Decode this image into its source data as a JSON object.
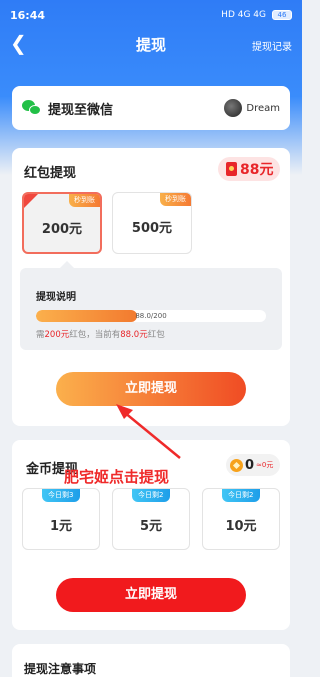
{
  "status_bar": {
    "time": "16:44",
    "indicators": "HD 4G 4G",
    "battery": "46"
  },
  "nav": {
    "back_icon": "chevron-left-icon",
    "title": "提现",
    "record_link": "提现记录"
  },
  "wechat": {
    "label": "提现至微信",
    "username": "Dream"
  },
  "red_packet": {
    "title": "红包提现",
    "balance": "88元",
    "options": [
      {
        "amount": "200元",
        "tag": "秒到账",
        "selected": true
      },
      {
        "amount": "500元",
        "tag": "秒到账",
        "selected": false
      }
    ],
    "explain": {
      "title": "提现说明",
      "progress_text": "88.0/200",
      "progress_fraction": 0.44,
      "note_prefix": "需",
      "note_need": "200元",
      "note_mid": "红包，当前有",
      "note_have": "88.0元",
      "note_suffix": "红包"
    },
    "button": "立即提现"
  },
  "gold": {
    "title": "金币提现",
    "coin_value": "0",
    "coin_equiv": "≈0元",
    "options": [
      {
        "amount": "1元",
        "tag": "今日剩3次"
      },
      {
        "amount": "5元",
        "tag": "今日剩2次"
      },
      {
        "amount": "10元",
        "tag": "今日剩2次"
      }
    ],
    "button": "立即提现"
  },
  "notes": {
    "title": "提现注意事项"
  },
  "annotation": {
    "caption": "肥宅姬点击提现",
    "arrow_color": "#ef2a2a"
  },
  "colors": {
    "accent_blue": "#2f7cf6",
    "red": "#e8262a",
    "orange": "#f27a2f"
  }
}
